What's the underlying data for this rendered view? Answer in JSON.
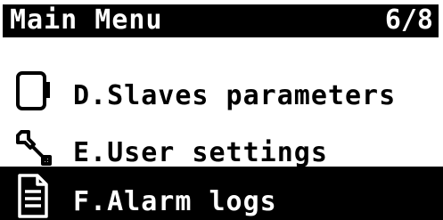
{
  "header": {
    "title": "Main Menu",
    "page_indicator": "6/8"
  },
  "menu": {
    "items": [
      {
        "label": "D.Slaves parameters",
        "icon": "slave-device-icon",
        "selected": false
      },
      {
        "label": "E.User settings",
        "icon": "wrench-settings-icon",
        "selected": false
      },
      {
        "label": "F.Alarm logs",
        "icon": "document-log-icon",
        "selected": true
      }
    ]
  },
  "colors": {
    "background": "#ffffff",
    "foreground": "#000000",
    "highlight": "#000000",
    "highlight_text": "#ffffff"
  }
}
